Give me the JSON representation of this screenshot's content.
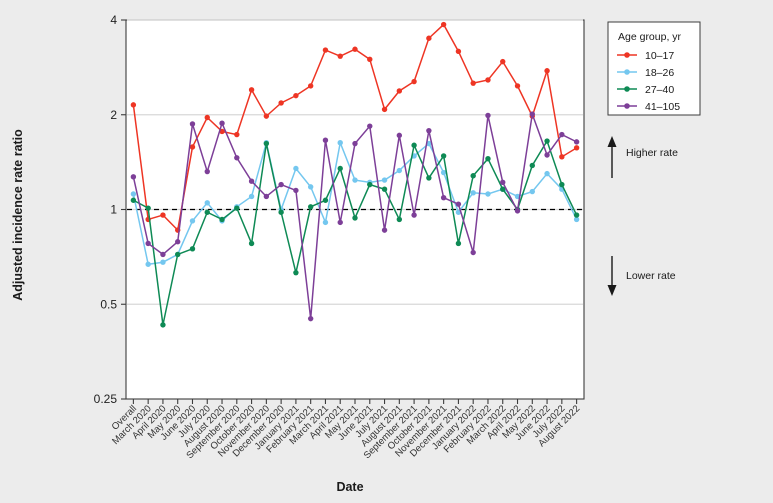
{
  "chart_data": {
    "type": "line",
    "title": "",
    "xlabel": "Date",
    "ylabel": "Adjusted incidence rate ratio",
    "yscale": "log",
    "ylim": [
      0.25,
      4
    ],
    "yticks": [
      0.25,
      0.5,
      1,
      2,
      4
    ],
    "ytick_labels": [
      "0.25",
      "0.5",
      "1",
      "2",
      "4"
    ],
    "grid": "horizontal",
    "reference_line": 1,
    "legend_position": "right-top",
    "legend_title": "Age group, yr",
    "categories": [
      "Overall",
      "March 2020",
      "April 2020",
      "May 2020",
      "June 2020",
      "July 2020",
      "August 2020",
      "September 2020",
      "October 2020",
      "November 2020",
      "December 2020",
      "January 2021",
      "February 2021",
      "March 2021",
      "April 2021",
      "May 2021",
      "June 2021",
      "July 2021",
      "August 2021",
      "September 2021",
      "October 2021",
      "November 2021",
      "December 2021",
      "January 2022",
      "February 2022",
      "March 2022",
      "April 2022",
      "May 2022",
      "June 2022",
      "July 2022",
      "August 2022"
    ],
    "series": [
      {
        "name": "10–17",
        "color": "#ee3524",
        "values": [
          2.15,
          0.93,
          0.96,
          0.86,
          1.58,
          1.96,
          1.77,
          1.73,
          2.4,
          1.98,
          2.18,
          2.3,
          2.47,
          3.21,
          3.07,
          3.23,
          3.0,
          2.08,
          2.38,
          2.55,
          3.5,
          3.87,
          3.18,
          2.52,
          2.58,
          2.95,
          2.47,
          1.98,
          2.76,
          1.47,
          1.57
        ]
      },
      {
        "name": "18–26",
        "color": "#74c7ef",
        "values": [
          1.12,
          0.67,
          0.68,
          0.72,
          0.92,
          1.05,
          0.92,
          1.02,
          1.1,
          1.63,
          1.0,
          1.35,
          1.18,
          0.91,
          1.63,
          1.24,
          1.22,
          1.24,
          1.33,
          1.48,
          1.62,
          1.31,
          0.98,
          1.13,
          1.12,
          1.16,
          1.1,
          1.14,
          1.3,
          1.16,
          0.93
        ]
      },
      {
        "name": "27–40",
        "color": "#0e8a55",
        "values": [
          1.07,
          1.01,
          0.43,
          0.72,
          0.75,
          0.98,
          0.93,
          1.01,
          0.78,
          1.62,
          0.98,
          0.63,
          1.02,
          1.07,
          1.35,
          0.94,
          1.2,
          1.16,
          0.93,
          1.6,
          1.26,
          1.48,
          0.78,
          1.28,
          1.45,
          1.16,
          1.0,
          1.38,
          1.65,
          1.2,
          0.96
        ]
      },
      {
        "name": "41–105",
        "color": "#7d3f98",
        "values": [
          1.27,
          0.78,
          0.72,
          0.79,
          1.87,
          1.32,
          1.88,
          1.46,
          1.23,
          1.1,
          1.2,
          1.15,
          0.45,
          1.66,
          0.91,
          1.62,
          1.84,
          0.86,
          1.72,
          0.96,
          1.78,
          1.09,
          1.04,
          0.73,
          1.99,
          1.22,
          0.99,
          2.01,
          1.49,
          1.73,
          1.64
        ]
      }
    ],
    "annotations": [
      {
        "id": "higher-rate",
        "label": "Higher rate",
        "direction": "up"
      },
      {
        "id": "lower-rate",
        "label": "Lower rate",
        "direction": "down"
      }
    ]
  }
}
